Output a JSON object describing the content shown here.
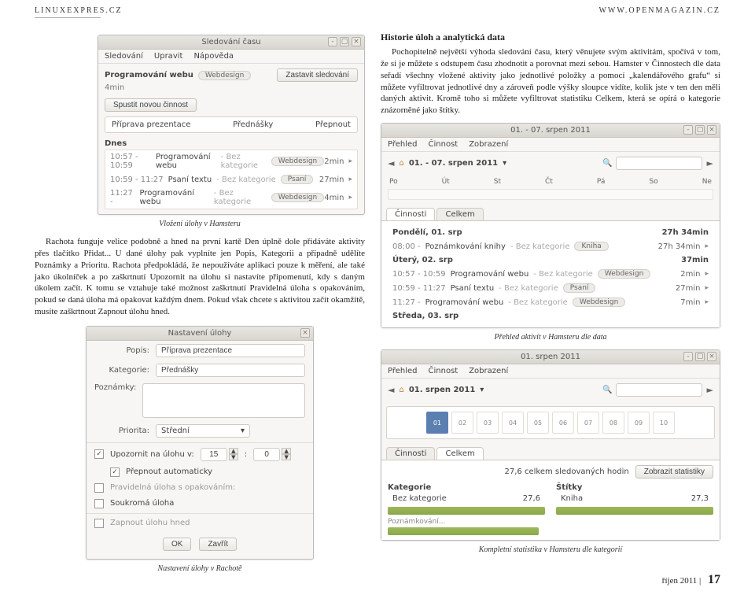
{
  "header": {
    "left": "LINUXEXPRES.CZ",
    "right": "WWW.OPENMAGAZIN.CZ"
  },
  "right_article": {
    "heading": "Historie úloh a analytická data",
    "body": "Pochopitelně největší výhoda sledování času, který věnujete svým aktivitám, spočívá v tom, že si je můžete s odstupem času zhodnotit a porovnat mezi sebou. Hamster v Činnostech dle data seřadí všechny vložené aktivity jako jednotlivé položky a pomocí „kalendářového grafu“ si můžete vyfiltrovat jednotlivé dny a zároveň podle výšky sloupce vidíte, kolik jste v ten den měli daných aktivit. Kromě toho si můžete vyfiltrovat statistiku Celkem, která se opírá o kategorie znázorněné jako štítky."
  },
  "left_article": {
    "caption1": "Vložení úlohy v Hamsteru",
    "body": "Rachota funguje velice podobně a hned na první kartě Den úplně dole přidáváte aktivity přes tlačítko Přidat... U dané úlohy pak vyplníte jen Popis, Kategorii a případně udělíte Poznámky a Prioritu. Rachota předpokládá, že nepoužíváte aplikaci pouze k měření, ale také jako úkolníček a po zaškrtnutí Upozornit na úlohu si nastavíte připomenutí, kdy s daným úkolem začít. K tomu se vztahuje také možnost zaškrtnutí Pravidelná úloha s opakováním, pokud se daná úloha má opakovat každým dnem. Pokud však chcete s aktivitou začít okamžitě, musíte zaškrtnout Zapnout úlohu hned.",
    "caption2": "Nastavení úlohy v Rachotě"
  },
  "right_captions": {
    "overview": "Přehled aktivit v Hamsteru dle data",
    "stats": "Kompletní statistika v Hamsteru dle kategorií"
  },
  "hamster_main": {
    "title": "Sledování času",
    "menu": [
      "Sledování",
      "Upravit",
      "Nápověda"
    ],
    "current_label": "Programování webu",
    "current_tag": "Webdesign",
    "current_dur": "4min",
    "stop_btn": "Zastavit sledování",
    "start_btn": "Spustit novou činnost",
    "col1": "Příprava prezentace",
    "col2": "Přednášky",
    "col3": "Přepnout",
    "day_label": "Dnes",
    "rows": [
      {
        "time": "10:57 - 10:59",
        "name": "Programování webu",
        "note": "- Bez kategorie",
        "tag": "Webdesign",
        "dur": "2min"
      },
      {
        "time": "10:59 - 11:27",
        "name": "Psaní textu",
        "note": "- Bez kategorie",
        "tag": "Psaní",
        "dur": "27min"
      },
      {
        "time": "11:27 -",
        "name": "Programování webu",
        "note": "- Bez kategorie",
        "tag": "Webdesign",
        "dur": "4min"
      }
    ]
  },
  "rachota": {
    "title": "Nastavení úlohy",
    "labels": {
      "popis": "Popis:",
      "kategorie": "Kategorie:",
      "poznamky": "Poznámky:",
      "priorita": "Priorita:"
    },
    "popis": "Příprava prezentace",
    "kategorie": "Přednášky",
    "priorita": "Střední",
    "chk_upozornit": "Upozornit na úlohu v:",
    "hh": "15",
    "mm": "0",
    "chk_prepnout": "Přepnout automaticky",
    "chk_pravidelna": "Pravidelná úloha s opakováním:",
    "chk_soukroma": "Soukromá úloha",
    "chk_zapnout": "Zapnout úlohu hned",
    "ok": "OK",
    "cancel": "Zavřít"
  },
  "hamster_overview": {
    "title": "01. - 07. srpen 2011",
    "tabs": [
      "Přehled",
      "Činnost",
      "Zobrazení"
    ],
    "date_nav": "01. - 07. srpen 2011",
    "days": [
      "Po",
      "Út",
      "St",
      "Čt",
      "Pá",
      "So",
      "Ne"
    ],
    "section_tabs": [
      "Činnosti",
      "Celkem"
    ],
    "groups": [
      {
        "day": "Pondělí, 01. srp",
        "dur": "27h 34min",
        "rows": [
          {
            "time": "08:00 -",
            "name": "Poznámkování knihy",
            "note": "- Bez kategorie",
            "tag": "Kniha",
            "dur": "27h 34min"
          }
        ]
      },
      {
        "day": "Úterý, 02. srp",
        "dur": "37min",
        "rows": [
          {
            "time": "10:57 - 10:59",
            "name": "Programování webu",
            "note": "- Bez kategorie",
            "tag": "Webdesign",
            "dur": "2min"
          },
          {
            "time": "10:59 - 11:27",
            "name": "Psaní textu",
            "note": "- Bez kategorie",
            "tag": "Psaní",
            "dur": "27min"
          },
          {
            "time": "11:27 -",
            "name": "Programování webu",
            "note": "- Bez kategorie",
            "tag": "Webdesign",
            "dur": "7min"
          }
        ]
      },
      {
        "day": "Středa, 03. srp",
        "dur": "",
        "rows": []
      }
    ]
  },
  "hamster_stats": {
    "title": "01. srpen 2011",
    "tabs": [
      "Přehled",
      "Činnost",
      "Zobrazení"
    ],
    "date_nav": "01. srpen 2011",
    "cal_days": [
      "01",
      "02",
      "03",
      "04",
      "05",
      "06",
      "07",
      "08",
      "09",
      "10"
    ],
    "section_tabs": [
      "Činnosti",
      "Celkem"
    ],
    "total_label": "27,6 celkem sledovaných hodin",
    "show_stats": "Zobrazit statistiky",
    "left_h": "Kategorie",
    "right_h": "Štítky",
    "left_rows": [
      {
        "name": "Bez kategorie",
        "val": "27,6"
      }
    ],
    "right_rows": [
      {
        "name": "Kniha",
        "val": "27,3"
      }
    ],
    "more": "Poznámkování..."
  },
  "footer": {
    "month": "říjen 2011",
    "page": "17"
  }
}
